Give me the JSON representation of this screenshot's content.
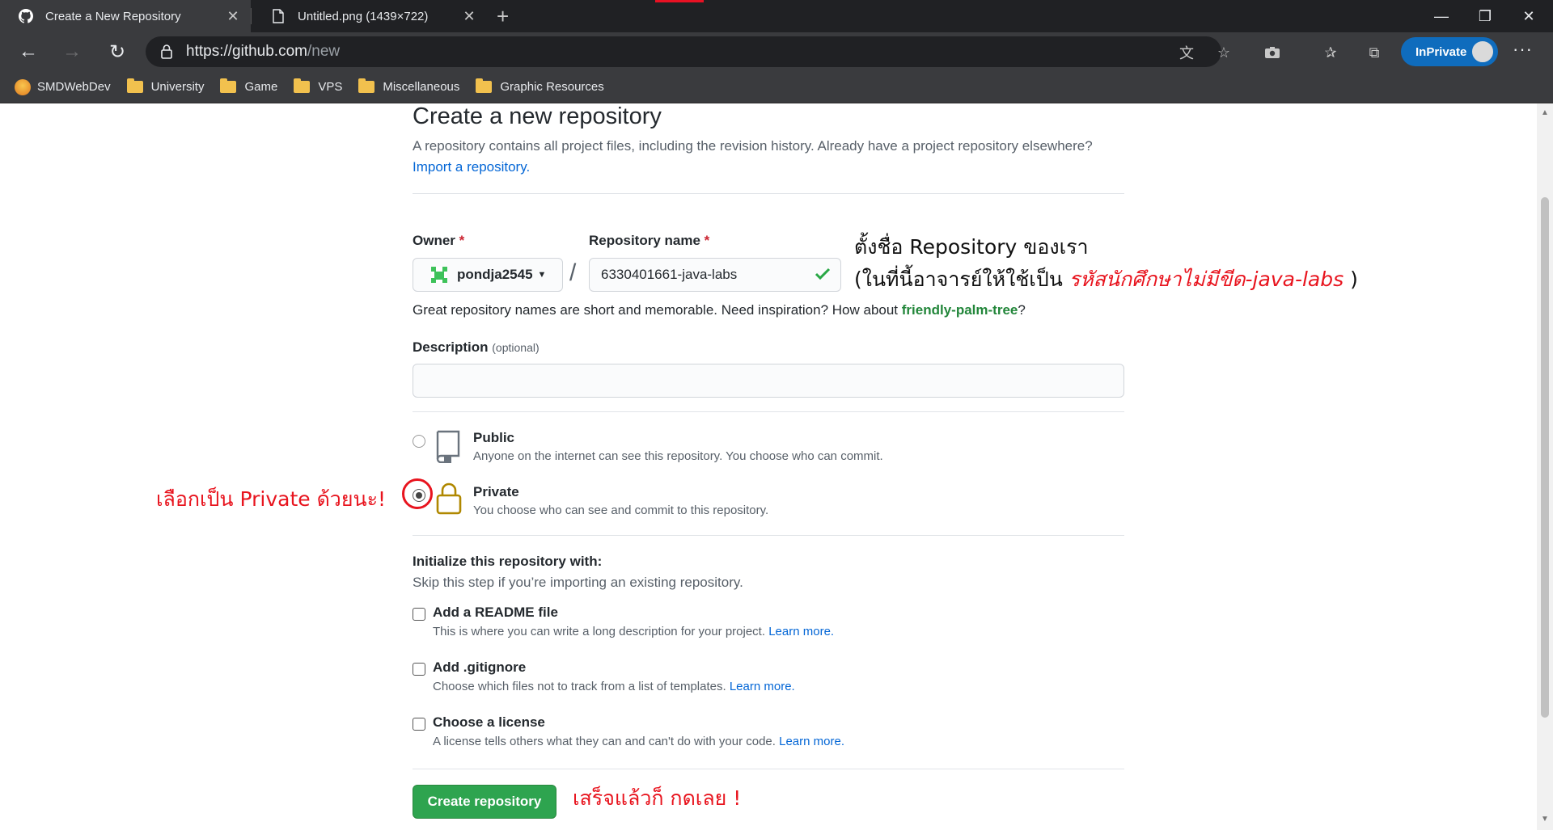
{
  "browser": {
    "tabs": [
      {
        "title": "Create a New Repository"
      },
      {
        "title": "Untitled.png (1439×722)"
      }
    ],
    "new_tab": "+",
    "url_host": "https://github.com",
    "url_path": "/new",
    "inprivate_label": "InPrivate",
    "bookmarks": [
      "SMDWebDev",
      "University",
      "Game",
      "VPS",
      "Miscellaneous",
      "Graphic Resources"
    ]
  },
  "page": {
    "title": "Create a new repository",
    "intro": "A repository contains all project files, including the revision history. Already have a project repository elsewhere?",
    "import_link": "Import a repository.",
    "owner_label": "Owner",
    "repo_label": "Repository name",
    "required_mark": "*",
    "owner_value": "pondja2545",
    "slash": "/",
    "repo_value": "6330401661-java-labs",
    "hint_prefix": "Great repository names are short and memorable. Need inspiration? How about",
    "hint_name": "friendly-palm-tree",
    "hint_suffix": "?",
    "description_label": "Description",
    "description_optional": "(optional)",
    "public_title": "Public",
    "public_desc": "Anyone on the internet can see this repository. You choose who can commit.",
    "private_title": "Private",
    "private_desc": "You choose who can see and commit to this repository.",
    "selected_visibility": "Private",
    "init_title": "Initialize this repository with:",
    "init_sub": "Skip this step if you’re importing an existing repository.",
    "options": [
      {
        "title": "Add a README file",
        "desc": "This is where you can write a long description for your project.",
        "link": "Learn more.",
        "checked": false
      },
      {
        "title": "Add .gitignore",
        "desc": "Choose which files not to track from a list of templates.",
        "link": "Learn more.",
        "checked": false
      },
      {
        "title": "Choose a license",
        "desc": "A license tells others what they can and can't do with your code.",
        "link": "Learn more.",
        "checked": false
      }
    ],
    "create_button": "Create repository"
  },
  "annotations": {
    "name_line1": "ตั้งชื่อ Repository ของเรา",
    "name_line2_prefix": "(ในที่นี้อาจารย์ให้ใช้เป็น",
    "name_line2_red": "รหัสนักศึกษาไม่มีขีด-java-labs",
    "name_line2_suffix": ")",
    "private_note": "เลือกเป็น Private ด้วยนะ!",
    "create_note": "เสร็จแล้วก็ กดเลย !"
  },
  "colors": {
    "annotation_red": "#e8141e",
    "github_green": "#2ea44f",
    "link_blue": "#0366d6"
  }
}
